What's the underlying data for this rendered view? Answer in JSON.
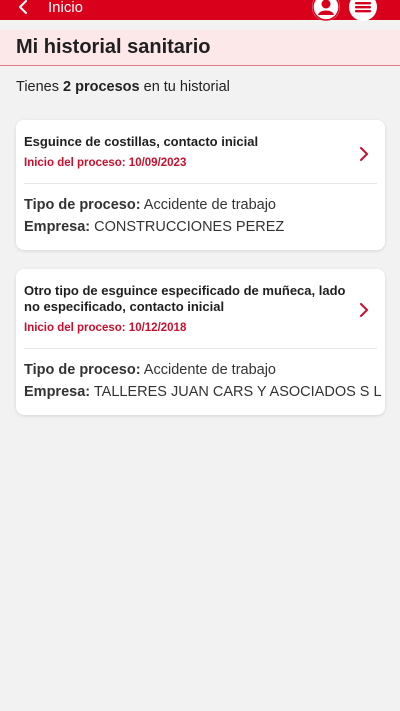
{
  "header": {
    "back_label": "Inicio",
    "back_icon": "chevron-left-icon",
    "user_icon": "user-icon",
    "menu_icon": "menu-icon",
    "brand_color": "#d9001b"
  },
  "page": {
    "title": "Mi historial sanitario"
  },
  "summary": {
    "prefix": "Tienes",
    "count_text": "2 procesos",
    "suffix": "en tu historial"
  },
  "processes": [
    {
      "title": "Esguince de costillas, contacto inicial",
      "start_label": "Inicio del proceso: 10/09/2023",
      "type_key": "Tipo de proceso:",
      "type_value": "Accidente de trabajo",
      "company_key": "Empresa:",
      "company_value": "CONSTRUCCIONES PEREZ"
    },
    {
      "title": "Otro tipo de esguince especificado de muñeca, lado no especificado, contacto inicial",
      "start_label": "Inicio del proceso: 10/12/2018",
      "type_key": "Tipo de proceso:",
      "type_value": "Accidente de trabajo",
      "company_key": "Empresa:",
      "company_value": "TALLERES JUAN CARS Y ASOCIADOS S L"
    }
  ]
}
